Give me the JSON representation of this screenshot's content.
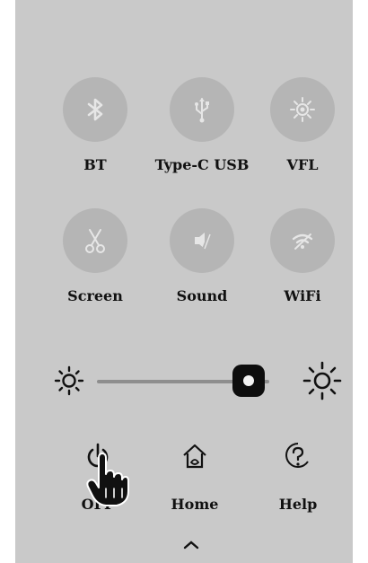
{
  "tiles": [
    {
      "label": "BT",
      "icon": "bluetooth-icon"
    },
    {
      "label": "Type-C USB",
      "icon": "usb-icon"
    },
    {
      "label": "VFL",
      "icon": "vfl-light-icon"
    },
    {
      "label": "Screen",
      "icon": "scissors-icon"
    },
    {
      "label": "Sound",
      "icon": "sound-muted-icon"
    },
    {
      "label": "WiFi",
      "icon": "wifi-off-icon"
    }
  ],
  "brightness": {
    "level": 0.88
  },
  "bottom": [
    {
      "label": "OFF",
      "icon": "power-icon"
    },
    {
      "label": "Home",
      "icon": "home-icon"
    },
    {
      "label": "Help",
      "icon": "help-icon"
    }
  ],
  "colors": {
    "panel": "#c9c9c9",
    "tile": "#b5b5b5",
    "icon": "#e6e6e6",
    "text": "#111111"
  }
}
